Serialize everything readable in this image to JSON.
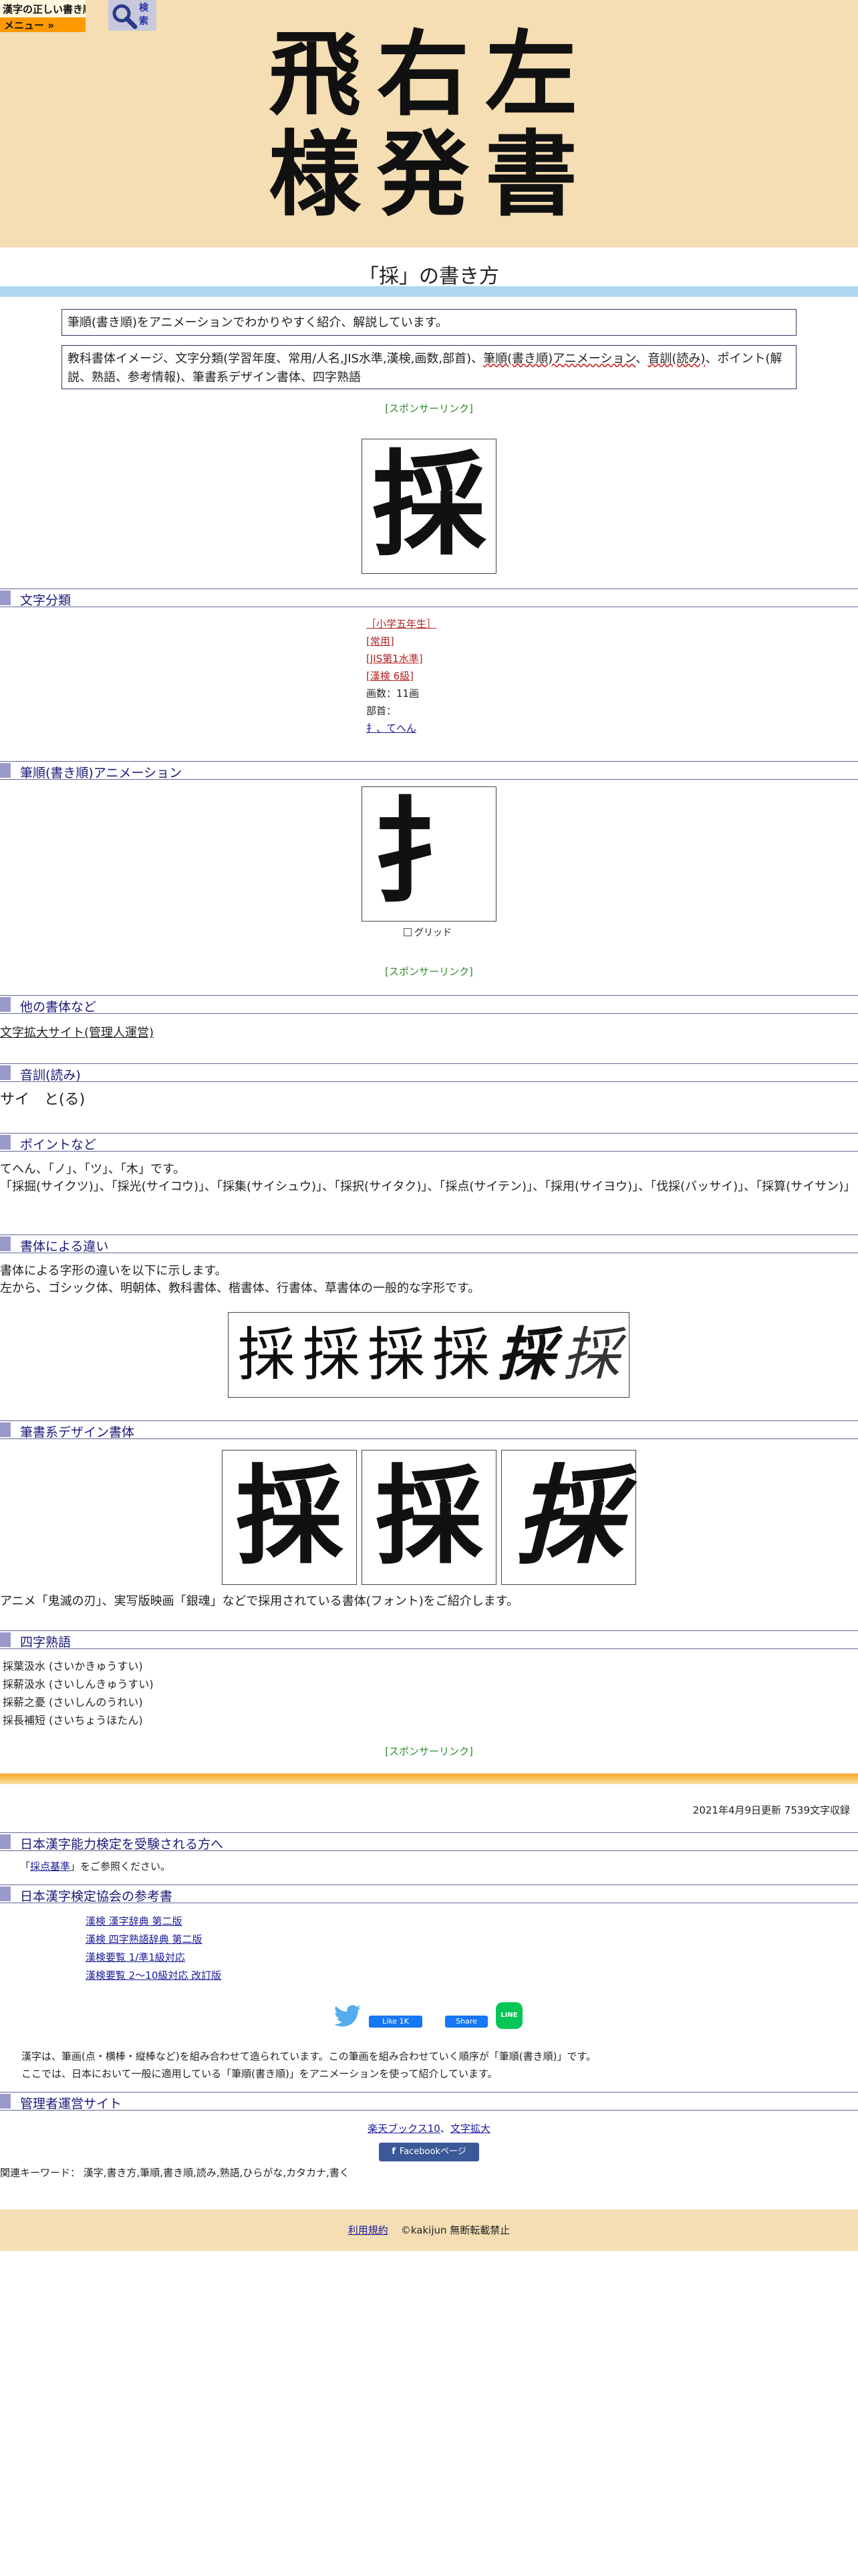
{
  "header": {
    "logo_text": "漢字の正しい書き順(筆順)",
    "menu_label": "メニュー »",
    "search_label": "検索",
    "hero_text": "飛右左様発書"
  },
  "page_title": "「採」の書き方",
  "intro": {
    "line1": "筆順(書き順)をアニメーションでわかりやすく紹介、解説しています。",
    "line2_a": "教科書体イメージ、文字分類(学習年度、常用/人名,JIS水準,漢検,画数,部首)、",
    "line2_red1": "筆順(書き順)アニメーション",
    "line2_b": "、",
    "line2_red2": "音訓(読み)",
    "line2_c": "、ポイント(解説、熟語、参考情報)、筆書系デザイン書体、四字熟語"
  },
  "sponsor_label": "[スポンサーリンク]",
  "kanji": "採",
  "sections": {
    "classification": "文字分類",
    "animation": "筆順(書き順)アニメーション",
    "other_fonts": "他の書体など",
    "reading": "音訓(読み)",
    "points": "ポイントなど",
    "font_diff": "書体による違い",
    "design_fonts": "筆書系デザイン書体",
    "idioms": "四字熟語",
    "kentei": "日本漢字能力検定を受験される方へ",
    "books": "日本漢字検定協会の参考書",
    "admin": "管理者運営サイト"
  },
  "classification": {
    "grade": "［小学五年生］",
    "joyo": "[常用]",
    "jis": "[JIS第1水準]",
    "kanken": "[漢検 6級]",
    "strokes": "画数：11画",
    "radical_label": "部首：",
    "radical": "扌、てへん"
  },
  "animation": {
    "partial": "扌",
    "grid_label": "グリッド"
  },
  "other_fonts_link": "文字拡大サイト(管理人運営)",
  "reading_text": "サイ　と(る)",
  "points": {
    "line1": "てへん、「ノ」、「ツ」、「木」です。",
    "line2": "「採掘(サイクツ)」、「採光(サイコウ)」、「採集(サイシュウ)」、「採択(サイタク)」、「採点(サイテン)」、「採用(サイヨウ)」、「伐採(バッサイ)」、「採算(サイサン)」"
  },
  "font_diff": {
    "line1": "書体による字形の違いを以下に示します。",
    "line2": "左から、ゴシック体、明朝体、教科書体、楷書体、行書体、草書体の一般的な字形です。"
  },
  "design_note": "アニメ「鬼滅の刃」、実写版映画「銀魂」などで採用されている書体(フォント)をご紹介します。",
  "idioms": [
    "採葉汲水 (さいかきゅうすい)",
    "採薪汲水 (さいしんきゅうすい)",
    "採薪之憂 (さいしんのうれい)",
    "採長補短 (さいちょうほたん)"
  ],
  "updated": "2021年4月9日更新 7539文字収録",
  "kentei_note": {
    "link": "採点基準",
    "text": "をご参照ください。"
  },
  "books": [
    "漢検 漢字辞典 第二版",
    "漢検 四字熟語辞典 第二版",
    "漢検要覧 1/準1級対応",
    "漢検要覧 2～10級対応 改訂版"
  ],
  "share": {
    "fb_like": "Like 1K",
    "fb_share": "Share",
    "line": "LINE"
  },
  "explain": {
    "line1": "漢字は、筆画(点・横棒・縦棒など)を組み合わせて造られています。この筆画を組み合わせていく順序が「筆順(書き順)」です。",
    "line2": "ここでは、日本において一般に適用している「筆順(書き順)」をアニメーションを使って紹介しています。"
  },
  "admin_links": {
    "link1": "楽天ブックス10",
    "sep": "、",
    "link2": "文字拡大"
  },
  "fb_page": "Facebookページ",
  "keywords": "関連キーワード： 漢字,書き方,筆順,書き順,読み,熟語,ひらがな,カタカナ,書く",
  "footer": {
    "terms": "利用規約",
    "copyright": "©kakijun 無断転載禁止"
  },
  "colors": {
    "header_bg": "#f5deb3",
    "menu_orange": "#ff9900",
    "section_accent": "#9999cc",
    "title_bar": "#add8f0"
  }
}
